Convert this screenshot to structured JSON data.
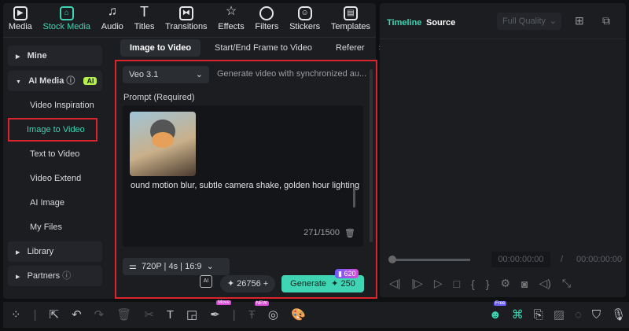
{
  "nav": [
    {
      "label": "Media",
      "icon": "media-icon"
    },
    {
      "label": "Stock Media",
      "icon": "stock-media-icon",
      "active": true
    },
    {
      "label": "Audio",
      "icon": "audio-icon"
    },
    {
      "label": "Titles",
      "icon": "titles-icon"
    },
    {
      "label": "Transitions",
      "icon": "transitions-icon"
    },
    {
      "label": "Effects",
      "icon": "effects-icon"
    },
    {
      "label": "Filters",
      "icon": "filters-icon"
    },
    {
      "label": "Stickers",
      "icon": "stickers-icon"
    },
    {
      "label": "Templates",
      "icon": "templates-icon"
    }
  ],
  "sidebar": {
    "mine": "Mine",
    "ai_media": "AI Media",
    "ai_badge": "AI",
    "items": [
      "Video Inspiration",
      "Image to Video",
      "Text to Video",
      "Video Extend",
      "AI Image",
      "My Files"
    ],
    "library": "Library",
    "partners": "Partners"
  },
  "tabs": [
    "Image to Video",
    "Start/End Frame to Video",
    "Referer"
  ],
  "form": {
    "model": "Veo 3.1",
    "model_desc": "Generate video with synchronized au...",
    "prompt_label": "Prompt (Required)",
    "prompt_text": "ound motion blur, subtle camera shake, golden hour lighting",
    "char_count": "271/1500",
    "resolution": "720P",
    "duration": "4s",
    "ratio": "16:9",
    "credits": "26756",
    "generate": "Generate",
    "cost": "250",
    "badge": "620"
  },
  "preview": {
    "tab_timeline": "Timeline",
    "tab_source": "Source",
    "quality": "Full Quality",
    "time_current": "00:00:00:00",
    "time_sep": "/",
    "time_total": "00:00:00:00"
  },
  "toolbar": {
    "badge_move": "Move",
    "badge_new": "NEW",
    "badge_free": "Free"
  },
  "colors": {
    "accent": "#3fd4b3",
    "highlight": "#d9252b"
  }
}
